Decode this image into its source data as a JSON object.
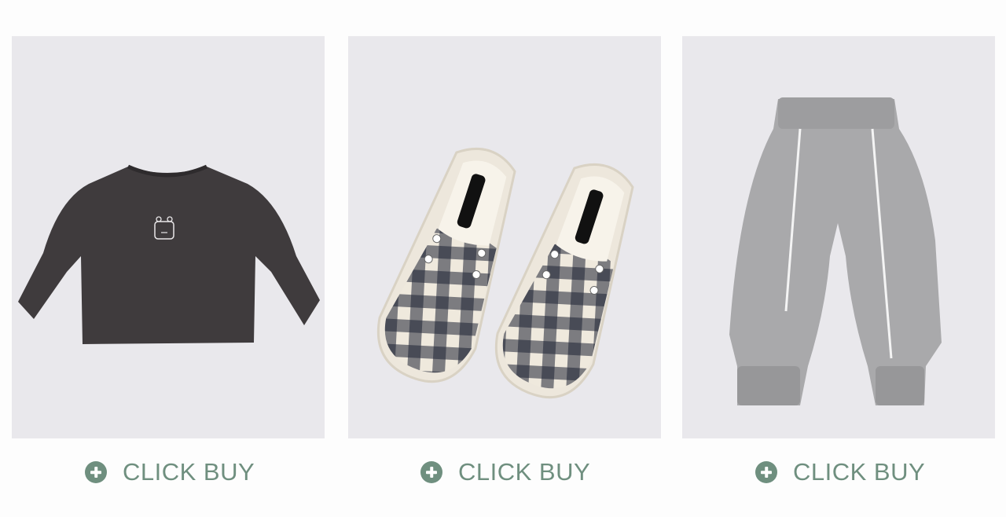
{
  "theme": {
    "accent": "#6f8f7f",
    "card_bg": "#e9e8ec"
  },
  "products": [
    {
      "item": "long-sleeve-tshirt",
      "button_label": "CLICK BUY",
      "button_icon": "plus-circle-icon"
    },
    {
      "item": "gingham-slip-on-shoes",
      "button_label": "CLICK BUY",
      "button_icon": "plus-circle-icon"
    },
    {
      "item": "grey-jogger-pants",
      "button_label": "CLICK BUY",
      "button_icon": "plus-circle-icon"
    }
  ]
}
